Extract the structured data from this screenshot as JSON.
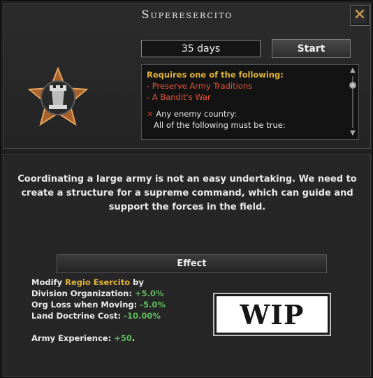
{
  "window": {
    "title": "Superesercito",
    "close_icon": "close-x-icon"
  },
  "decision": {
    "duration": "35 days",
    "start_label": "Start",
    "emblem_icon": "chess-rook-star-emblem-icon"
  },
  "requirements": {
    "header": "Requires one of the following:",
    "items": [
      "- Preserve Army Traditions",
      "- A Bandit's War"
    ],
    "condition": "Any enemy country:",
    "sub_condition": "All of the following must be true:"
  },
  "description": {
    "line1": "Coordinating a large army is not an easy undertaking. We need to",
    "line2": "create a structure for a supreme command, which can guide and",
    "line3": "support the forces in the field."
  },
  "effect": {
    "header": "Effect",
    "modify_prefix": "Modify ",
    "target": "Regio Esercito",
    "modify_suffix": " by",
    "modifiers": [
      {
        "label": "Division Organization: ",
        "value": "+5.0%"
      },
      {
        "label": "Org Loss when Moving: ",
        "value": "-5.0%"
      },
      {
        "label": "Land Doctrine Cost: ",
        "value": "-10.00%"
      }
    ],
    "army_xp_label": "Army Experience: ",
    "army_xp_value": "+50",
    "army_xp_end": "."
  },
  "image": {
    "wip_text": "WIP"
  },
  "colors": {
    "gold": "#e0b33a",
    "red": "#e0543a",
    "green": "#5fb85f"
  }
}
